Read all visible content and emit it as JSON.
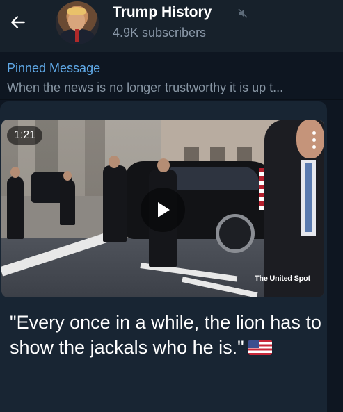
{
  "header": {
    "back_icon": "arrow-left-icon",
    "channel_name": "Trump History",
    "muted_icon": "mute-icon",
    "subscribers": "4.9K subscribers"
  },
  "pinned": {
    "title": "Pinned Message",
    "text": "When the news is no longer trustworthy it is up t..."
  },
  "message": {
    "video": {
      "duration": "1:21",
      "play_icon": "play-icon",
      "menu_icon": "more-vertical-icon",
      "watermark": "The United Spot"
    },
    "caption": "\"Every once in a while, the lion has to show the jackals who he is.\"",
    "caption_emoji": "us-flag-emoji"
  },
  "colors": {
    "header_bg": "#17212b",
    "chat_bg": "#0e1621",
    "bubble_bg": "#182533",
    "link_blue": "#5fa8e6",
    "secondary_text": "#8896a4"
  }
}
